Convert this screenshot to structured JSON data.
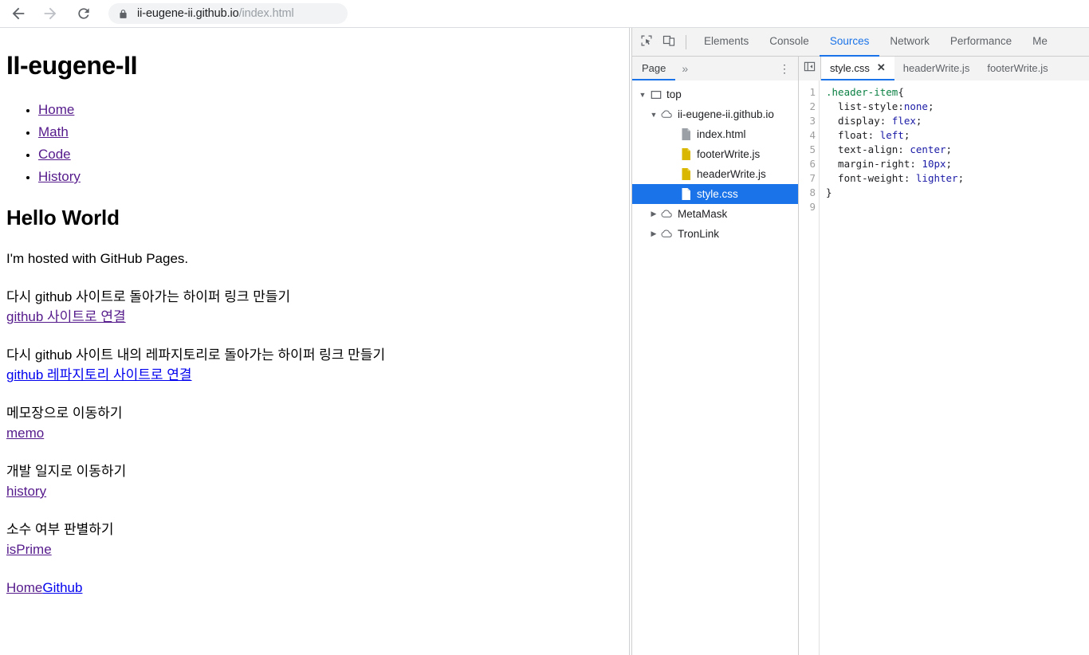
{
  "browser": {
    "back_icon": "arrow-left-icon",
    "forward_icon": "arrow-right-icon",
    "reload_icon": "reload-icon",
    "lock_icon": "lock-icon",
    "url_domain": "ii-eugene-ii.github.io",
    "url_path": "/index.html",
    "url_full": "ii-eugene-ii.github.io/index.html"
  },
  "page": {
    "title": "II-eugene-II",
    "nav_links": [
      {
        "label": "Home"
      },
      {
        "label": "Math"
      },
      {
        "label": "Code"
      },
      {
        "label": "History"
      }
    ],
    "hello_heading": "Hello World",
    "hosted_text": "I'm hosted with GitHub Pages.",
    "sections": [
      {
        "text": "다시 github 사이트로 돌아가는 하이퍼 링크 만들기",
        "link": "github 사이트로 연결",
        "link_state": "visited"
      },
      {
        "text": "다시 github 사이트 내의 레파지토리로 돌아가는 하이퍼 링크 만들기",
        "link": "github 레파지토리 사이트로 연결",
        "link_state": "fresh"
      },
      {
        "text": "메모장으로 이동하기",
        "link": "memo",
        "link_state": "visited"
      },
      {
        "text": "개발 일지로 이동하기",
        "link": "history",
        "link_state": "visited"
      },
      {
        "text": "소수 여부 판별하기",
        "link": "isPrime",
        "link_state": "visited"
      }
    ],
    "footer_home": "Home",
    "footer_github": "Github"
  },
  "devtools": {
    "inspect_icon": "inspect-element-icon",
    "device_icon": "device-toolbar-icon",
    "tabs": [
      {
        "label": "Elements",
        "active": false
      },
      {
        "label": "Console",
        "active": false
      },
      {
        "label": "Sources",
        "active": true
      },
      {
        "label": "Network",
        "active": false
      },
      {
        "label": "Performance",
        "active": false
      },
      {
        "label": "Me",
        "active": false
      }
    ],
    "nav_tab": "Page",
    "nav_overflow": "»",
    "nav_menu": "⋮",
    "sidebar_toggle_icon": "panel-collapse-icon",
    "editor_tabs": [
      {
        "label": "style.css",
        "active": true,
        "close": "✕"
      },
      {
        "label": "headerWrite.js",
        "active": false
      },
      {
        "label": "footerWrite.js",
        "active": false
      }
    ],
    "file_tree": [
      {
        "label": "top",
        "depth": 0,
        "arrow": "▼",
        "icon": "frame-icon",
        "selected": false
      },
      {
        "label": "ii-eugene-ii.github.io",
        "depth": 1,
        "arrow": "▼",
        "icon": "cloud-icon",
        "selected": false
      },
      {
        "label": "index.html",
        "depth": 2,
        "arrow": "",
        "icon": "html-file-icon",
        "selected": false
      },
      {
        "label": "footerWrite.js",
        "depth": 2,
        "arrow": "",
        "icon": "js-file-icon",
        "selected": false
      },
      {
        "label": "headerWrite.js",
        "depth": 2,
        "arrow": "",
        "icon": "js-file-icon",
        "selected": false
      },
      {
        "label": "style.css",
        "depth": 2,
        "arrow": "",
        "icon": "css-file-icon",
        "selected": true
      },
      {
        "label": "MetaMask",
        "depth": 1,
        "arrow": "▶",
        "icon": "cloud-icon",
        "selected": false
      },
      {
        "label": "TronLink",
        "depth": 1,
        "arrow": "▶",
        "icon": "cloud-icon",
        "selected": false
      }
    ],
    "code": {
      "line_numbers": [
        "1",
        "2",
        "3",
        "4",
        "5",
        "6",
        "7",
        "8",
        "9"
      ],
      "lines": [
        {
          "selector": ".header-item",
          "brace": "{"
        },
        {
          "prop": "  list-style:",
          "value": "none",
          "semi": ";"
        },
        {
          "prop": "  display: ",
          "value": "flex",
          "semi": ";"
        },
        {
          "prop": "  float: ",
          "value": "left",
          "semi": ";"
        },
        {
          "prop": "  text-align: ",
          "value": "center",
          "semi": ";"
        },
        {
          "prop": "  margin-right: ",
          "value": "10px",
          "semi": ";"
        },
        {
          "prop": "  font-weight: ",
          "value": "lighter",
          "semi": ";"
        },
        {
          "brace": "}"
        },
        {
          "empty": ""
        }
      ]
    }
  },
  "colors": {
    "accent_blue": "#1a73e8",
    "visited_link": "#551a8b",
    "fresh_link": "#0000ee",
    "css_selector": "#0b8043",
    "css_value": "#1a1aa6",
    "js_file": "#d9b700"
  }
}
